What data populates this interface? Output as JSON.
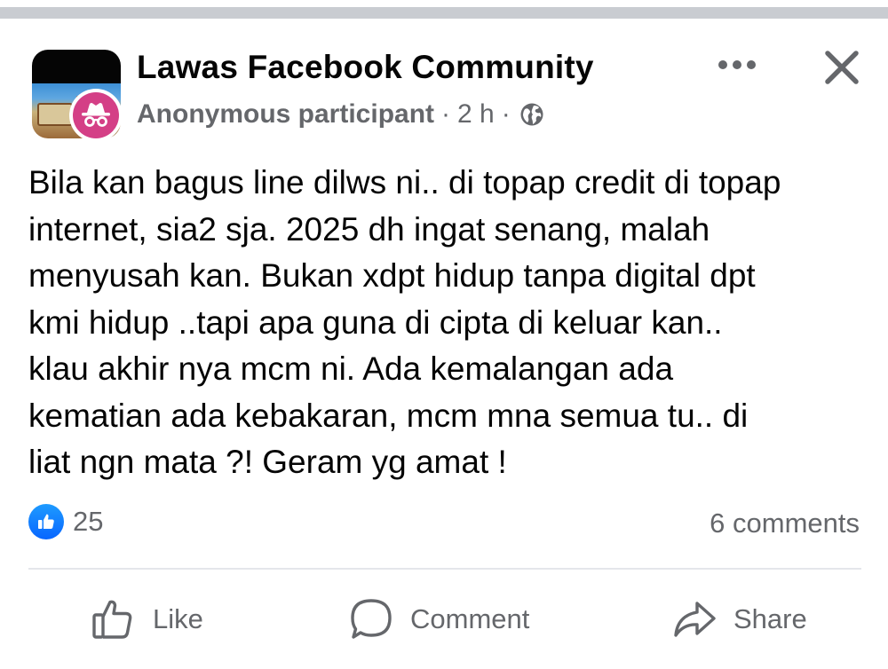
{
  "header": {
    "group_name": "Lawas Facebook Community",
    "author": "Anonymous participant",
    "separator": "·",
    "time": "2 h",
    "privacy_icon": "globe-icon",
    "more_icon": "more-horizontal-icon",
    "close_icon": "close-icon",
    "avatar_badge_icon": "anonymous-incognito-icon"
  },
  "post": {
    "text": "Bila kan bagus line dilws ni.. di topap credit di topap\ninternet, sia2 sja. 2025 dh ingat senang, malah\nmenyusah kan. Bukan xdpt hidup tanpa digital dpt\nkmi hidup ..tapi apa guna di cipta di keluar kan..\nklau akhir nya mcm ni. Ada kemalangan ada\nkematian ada kebakaran, mcm mna semua tu.. di\nliat ngn mata ?! Geram yg amat !"
  },
  "engagement": {
    "reaction_count": "25",
    "reaction_icon": "like-reaction-icon",
    "comments": "6 comments"
  },
  "actions": {
    "like_label": "Like",
    "comment_label": "Comment",
    "share_label": "Share"
  },
  "colors": {
    "primary_text": "#050505",
    "secondary_text": "#65676b",
    "facebook_blue": "#0866ff",
    "anonymous_badge": "#d43f86",
    "divider": "#e4e6eb"
  }
}
